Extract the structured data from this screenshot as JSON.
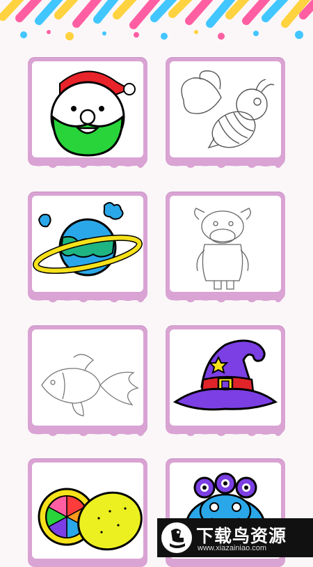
{
  "header": {
    "decoration": "confetti-stripes"
  },
  "gallery": {
    "cards": [
      {
        "subject": "santa-claus",
        "state": "colored"
      },
      {
        "subject": "bee",
        "state": "outline"
      },
      {
        "subject": "planet",
        "state": "colored"
      },
      {
        "subject": "cow",
        "state": "outline"
      },
      {
        "subject": "fish",
        "state": "outline"
      },
      {
        "subject": "witch-hat",
        "state": "colored"
      },
      {
        "subject": "lemon",
        "state": "colored"
      },
      {
        "subject": "frog-monster",
        "state": "colored"
      }
    ]
  },
  "watermark": {
    "title": "下载鸟资源",
    "url": "www.xiazainiao.com"
  },
  "colors": {
    "card_frame": "#d9a3d3",
    "page_bg": "#fbf7f9",
    "watermark_bg": "#111111"
  }
}
